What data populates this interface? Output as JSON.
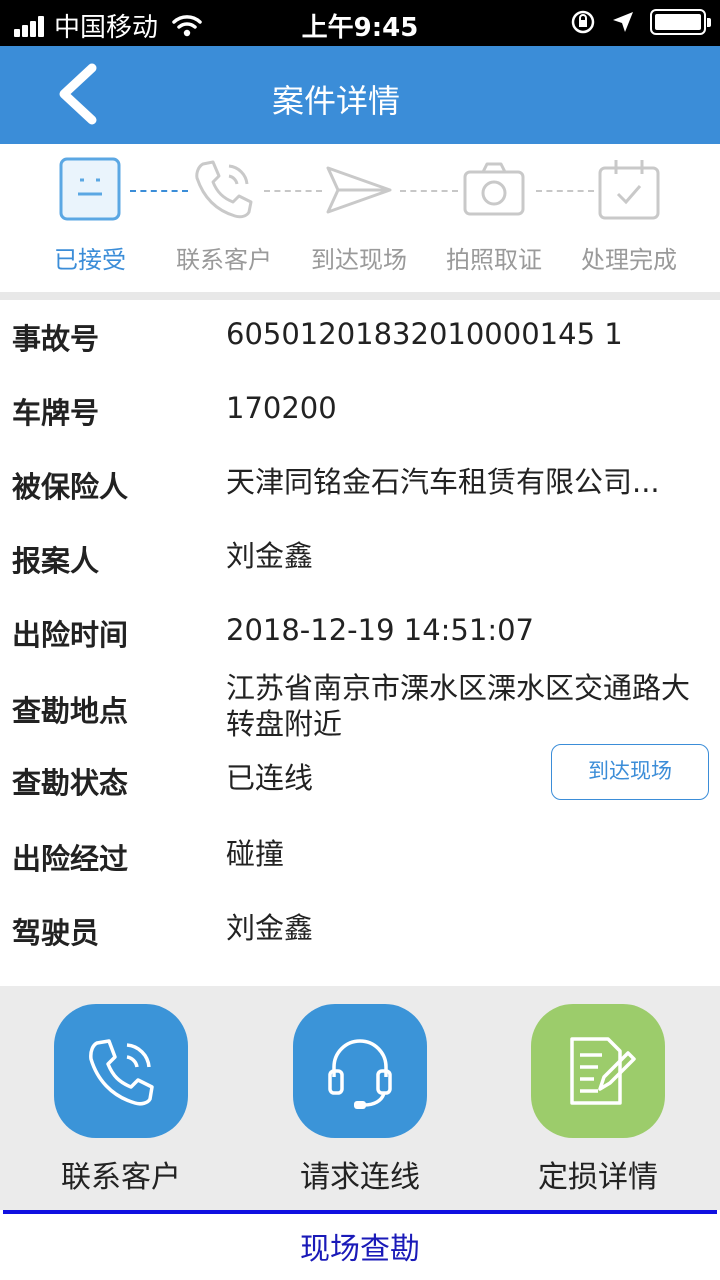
{
  "status_bar": {
    "carrier": "中国移动",
    "time": "上午9:45"
  },
  "nav": {
    "title": "案件详情"
  },
  "steps": [
    {
      "label": "已接受",
      "icon": "document-icon",
      "active": true
    },
    {
      "label": "联系客户",
      "icon": "phone-icon",
      "active": false
    },
    {
      "label": "到达现场",
      "icon": "paper-plane-icon",
      "active": false
    },
    {
      "label": "拍照取证",
      "icon": "camera-icon",
      "active": false
    },
    {
      "label": "处理完成",
      "icon": "calendar-check-icon",
      "active": false
    }
  ],
  "details": [
    {
      "key": "事故号",
      "value": "60501201832010000145 1"
    },
    {
      "key": "车牌号",
      "value": "170200"
    },
    {
      "key": "被保险人",
      "value": "天津同铭金石汽车租赁有限公司..."
    },
    {
      "key": "报案人",
      "value": "刘金鑫"
    },
    {
      "key": "出险时间",
      "value": "2018-12-19 14:51:07"
    },
    {
      "key": "查勘地点",
      "value": "江苏省南京市溧水区溧水区交通路大转盘附近"
    },
    {
      "key": "查勘状态",
      "value": "已连线"
    },
    {
      "key": "出险经过",
      "value": "碰撞"
    },
    {
      "key": "驾驶员",
      "value": "刘金鑫"
    }
  ],
  "arrive_button": "到达现场",
  "actions": [
    {
      "label": "联系客户",
      "icon": "phone-icon",
      "color": "#3b94d8"
    },
    {
      "label": "请求连线",
      "icon": "headset-icon",
      "color": "#3b94d8"
    },
    {
      "label": "定损详情",
      "icon": "document-edit-icon",
      "color": "#9ccc6b"
    }
  ],
  "tab": {
    "label": "现场查勘"
  },
  "colors": {
    "primary": "#3b8dd8",
    "accent_green": "#9ccc6b"
  }
}
